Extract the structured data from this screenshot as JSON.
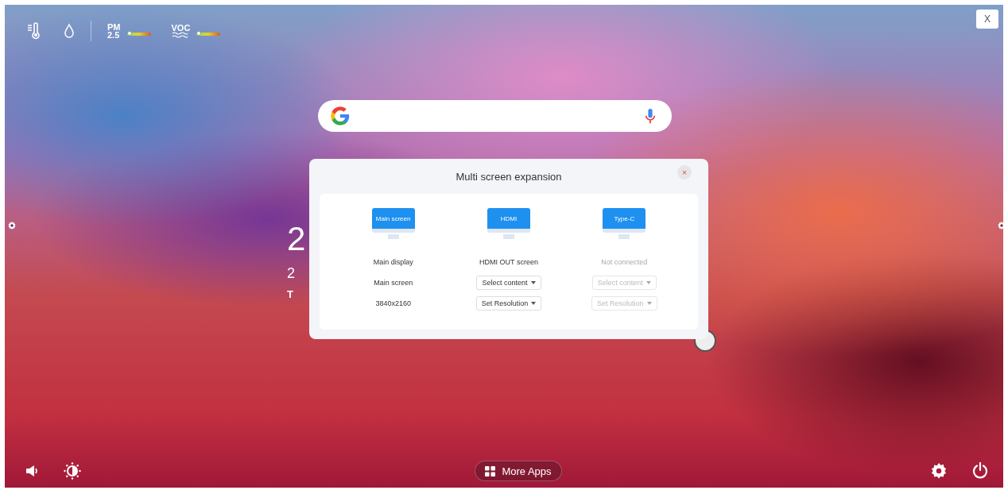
{
  "top_bar": {
    "sensors": [
      {
        "kind": "temperature"
      },
      {
        "kind": "humidity"
      },
      {
        "kind": "pm",
        "label": "PM",
        "sublabel": "2.5",
        "level": 0.1
      },
      {
        "kind": "voc",
        "label": "VOC",
        "level": 0.1
      }
    ]
  },
  "close_label": "X",
  "clock": {
    "time": "2",
    "date": "2",
    "weekday": "T"
  },
  "dialog": {
    "title": "Multi screen expansion",
    "close": "×",
    "outputs": [
      {
        "kind": "static",
        "screen_label": "Main screen",
        "name": "Main display",
        "content": "Main screen",
        "resolution": "3840x2160",
        "disabled": false
      },
      {
        "kind": "dropdown",
        "screen_label": "HDMI",
        "name": "HDMI OUT screen",
        "content": "Select content",
        "resolution": "Set Resolution",
        "disabled": false
      },
      {
        "kind": "dropdown",
        "screen_label": "Type-C",
        "name": "Not connected",
        "content": "Select content",
        "resolution": "Set Resolution",
        "disabled": true
      }
    ]
  },
  "bottom_bar": {
    "more_apps": "More Apps"
  }
}
